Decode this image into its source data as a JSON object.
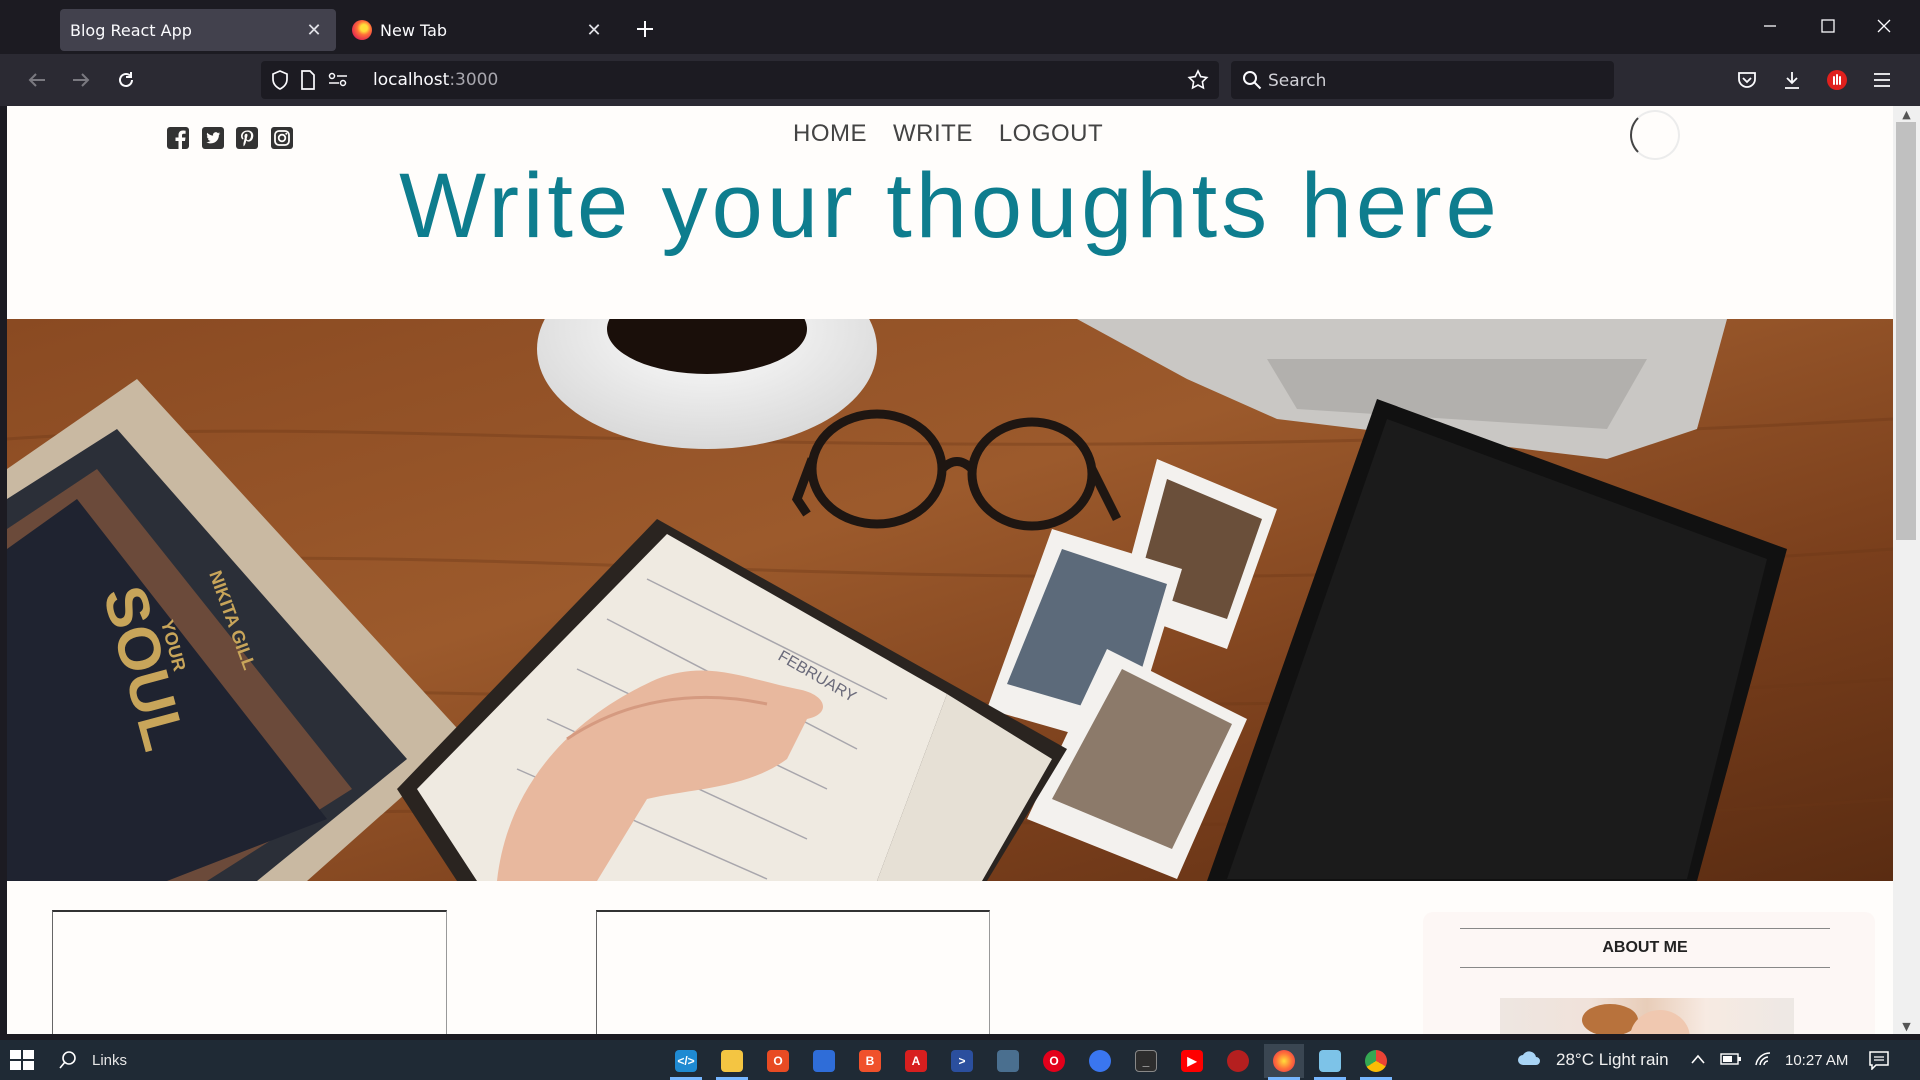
{
  "browser": {
    "tabs": [
      {
        "title": "Blog React App",
        "active": true
      },
      {
        "title": "New Tab",
        "active": false
      }
    ],
    "url": {
      "host": "localhost",
      "port": ":3000"
    },
    "search_placeholder": "Search"
  },
  "site": {
    "social_icons": [
      "facebook-icon",
      "twitter-icon",
      "pinterest-icon",
      "instagram-icon"
    ],
    "menu": [
      "HOME",
      "WRITE",
      "LOGOUT"
    ],
    "hero_title": "Write your thoughts here",
    "hero_image_book_text": [
      "SOUL",
      "YOUR",
      "NIKITA GILL"
    ],
    "hero_image_notebook_text": "FEBRUARY",
    "sidebar": {
      "title": "ABOUT ME"
    },
    "accent_color": "#0e7d8e"
  },
  "taskbar": {
    "search_label": "Links",
    "weather": "28°C  Light rain",
    "time": "10:27 AM",
    "apps": [
      "vscode",
      "file-explorer",
      "office",
      "unknown-blue",
      "brave",
      "pdf-reader",
      "powershell",
      "remote-desktop",
      "opera",
      "signal",
      "terminal",
      "youtube",
      "unknown-red",
      "firefox",
      "notepad",
      "chrome"
    ]
  }
}
